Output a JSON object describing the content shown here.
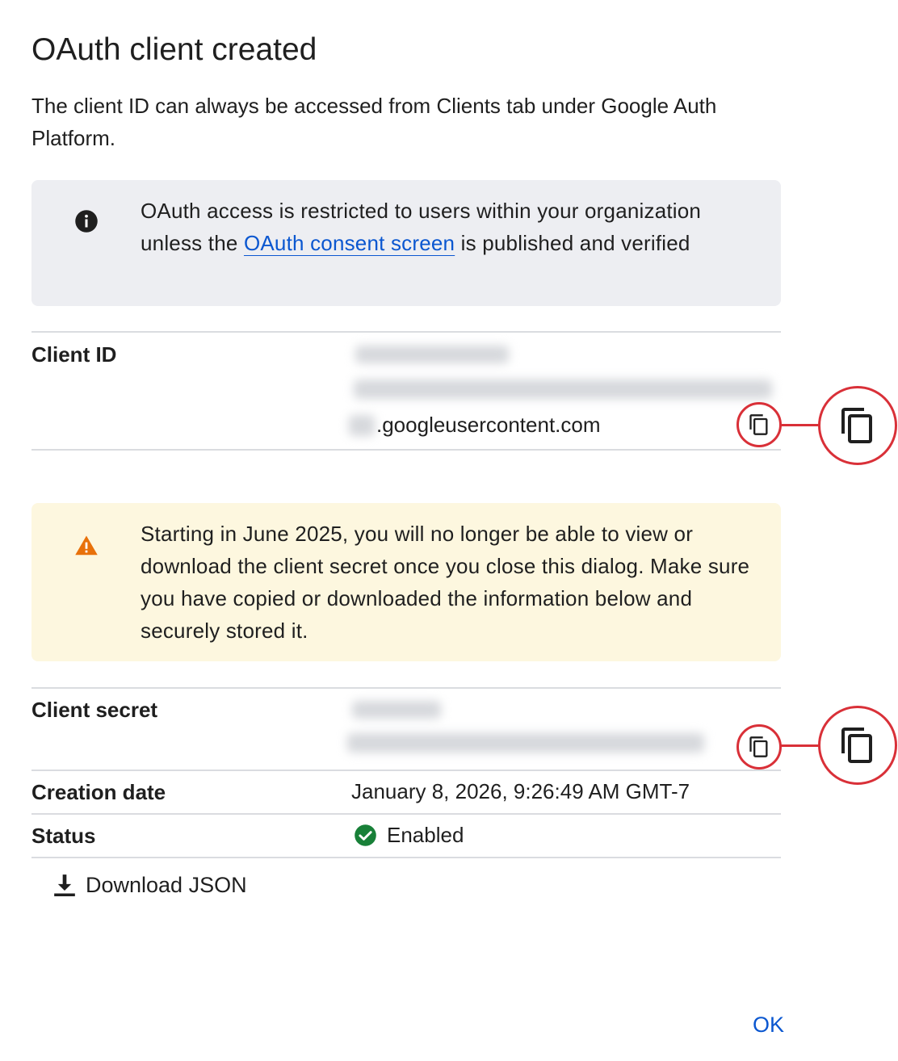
{
  "dialog": {
    "title": "OAuth client created",
    "subtitle": "The client ID can always be accessed from Clients tab under Google Auth Platform."
  },
  "info_banner": {
    "icon": "info-icon",
    "text_before": "OAuth access is restricted to users within your organization unless the ",
    "link": "OAuth consent screen",
    "text_after": " is published and verified"
  },
  "client_id": {
    "label": "Client ID",
    "value_suffix": ".googleusercontent.com",
    "copy_icon": "copy-icon"
  },
  "warning_banner": {
    "icon": "warning-icon",
    "text": "Starting in June 2025, you will no longer be able to view or download the client secret once you close this dialog. Make sure you have copied or downloaded the information below and securely stored it."
  },
  "client_secret": {
    "label": "Client secret",
    "copy_icon": "copy-icon"
  },
  "creation_date": {
    "label": "Creation date",
    "value": "January 8, 2026, 9:26:49 AM GMT-7"
  },
  "status": {
    "label": "Status",
    "value": "Enabled",
    "icon": "check-circle-icon"
  },
  "actions": {
    "download_label": "Download JSON",
    "ok_label": "OK"
  },
  "colors": {
    "link": "#0b57d0",
    "info_bg": "#edeef2",
    "warning_bg": "#fdf7df",
    "warning_icon": "#e8710a",
    "success": "#188038",
    "highlight": "#d93038"
  }
}
